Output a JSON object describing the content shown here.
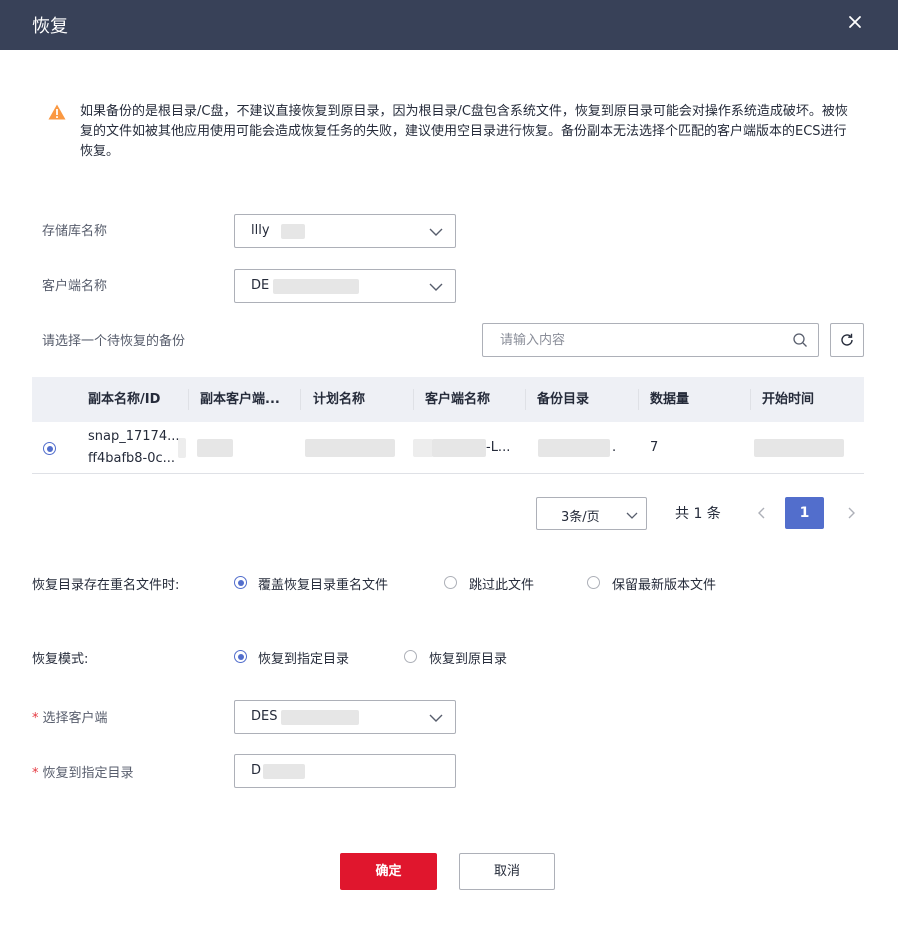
{
  "dialog": {
    "title": "恢复"
  },
  "warning": {
    "text": "如果备份的是根目录/C盘，不建议直接恢复到原目录，因为根目录/C盘包含系统文件，恢复到原目录可能会对操作系统造成破坏。被恢复的文件如被其他应用使用可能会造成恢复任务的失败，建议使用空目录进行恢复。备份副本无法选择个匹配的客户端版本的ECS进行恢复。"
  },
  "form": {
    "vault_label": "存储库名称",
    "vault_value": "llly",
    "client_label": "客户端名称",
    "client_value": "DE",
    "backup_select_label": "请选择一个待恢复的备份",
    "search_placeholder": "请输入内容"
  },
  "table": {
    "columns": [
      "副本名称/ID",
      "副本客户端...",
      "计划名称",
      "客户端名称",
      "备份目录",
      "数据量",
      "开始时间"
    ],
    "rows": [
      {
        "replica_name": "snap_17174...",
        "replica_id": "ff4bafb8-0c...",
        "client_name_suffix": "-L...",
        "backup_dir_suffix": ".",
        "data_size": "7"
      }
    ]
  },
  "pagination": {
    "page_size": "3条/页",
    "total": "共 1 条",
    "current_page": "1"
  },
  "conflict": {
    "label": "恢复目录存在重名文件时:",
    "options": [
      "覆盖恢复目录重名文件",
      "跳过此文件",
      "保留最新版本文件"
    ],
    "selected": "覆盖恢复目录重名文件"
  },
  "mode": {
    "label": "恢复模式:",
    "options": [
      "恢复到指定目录",
      "恢复到原目录"
    ],
    "selected": "恢复到指定目录"
  },
  "target": {
    "client_label": "选择客户端",
    "client_value": "DES",
    "dir_label": "恢复到指定目录",
    "dir_value": "D",
    "required_mark": "*"
  },
  "buttons": {
    "ok": "确定",
    "cancel": "取消"
  },
  "colors": {
    "header_bg": "#384158",
    "primary": "#526ecc",
    "danger": "#e0162d",
    "warning": "#fa9841"
  },
  "icons": [
    "close-icon",
    "warning-icon",
    "chevron-down-icon",
    "search-icon",
    "refresh-icon",
    "chevron-left-icon",
    "chevron-right-icon"
  ]
}
